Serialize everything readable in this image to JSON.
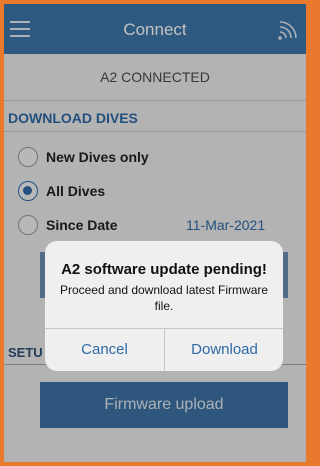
{
  "header": {
    "title": "Connect",
    "menu_icon": "hamburger-icon",
    "connection_icon": "wifi-signal-icon"
  },
  "status": {
    "text": "A2 CONNECTED"
  },
  "download": {
    "section_title": "DOWNLOAD DIVES",
    "options": [
      {
        "label": "New Dives only",
        "selected": false
      },
      {
        "label": "All Dives",
        "selected": true
      },
      {
        "label": "Since Date",
        "selected": false,
        "value": "11-Mar-2021"
      }
    ]
  },
  "setup": {
    "section_title": "SETU",
    "firmware_button": "Firmware upload"
  },
  "dialog": {
    "title": "A2 software update pending!",
    "message": "Proceed and download latest Firmware file.",
    "cancel_label": "Cancel",
    "download_label": "Download"
  },
  "colors": {
    "accent": "#2e6aa7",
    "header": "#3d75a9",
    "frame": "#e9792c"
  }
}
